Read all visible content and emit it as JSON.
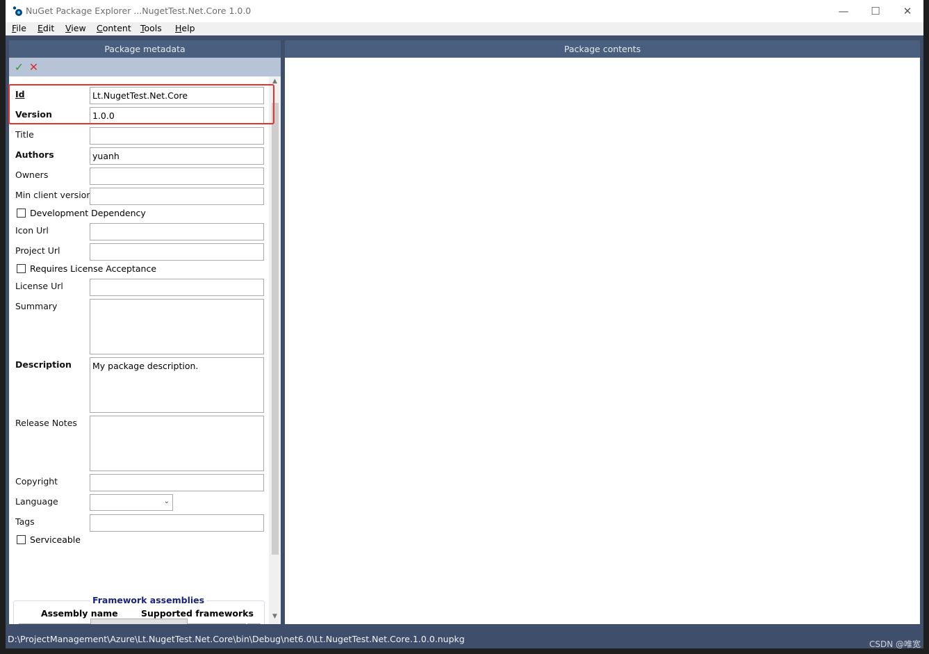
{
  "window": {
    "title": "NuGet Package Explorer ...NugetTest.Net.Core 1.0.0",
    "controls": {
      "minimize": "—",
      "maximize": "☐",
      "close": "✕"
    }
  },
  "menu": [
    "File",
    "Edit",
    "View",
    "Content",
    "Tools",
    "Help"
  ],
  "left_panel": {
    "header": "Package metadata",
    "toolbar": {
      "ok_icon": "check-icon",
      "ok_glyph": "✓",
      "cancel_icon": "x-icon",
      "cancel_glyph": "✕",
      "ok_color": "#2e9b3a",
      "cancel_color": "#d9302c"
    },
    "fields": {
      "id": {
        "label": "Id",
        "value": "Lt.NugetTest.Net.Core"
      },
      "version": {
        "label": "Version",
        "value": "1.0.0"
      },
      "title": {
        "label": "Title",
        "value": ""
      },
      "authors": {
        "label": "Authors",
        "value": "yuanh"
      },
      "owners": {
        "label": "Owners",
        "value": ""
      },
      "min_client_version": {
        "label": "Min client version",
        "value": ""
      },
      "development_dependency": {
        "label": "Development Dependency",
        "checked": false
      },
      "icon_url": {
        "label": "Icon Url",
        "value": ""
      },
      "project_url": {
        "label": "Project Url",
        "value": ""
      },
      "requires_license_acceptance": {
        "label": "Requires License Acceptance",
        "checked": false
      },
      "license_url": {
        "label": "License Url",
        "value": ""
      },
      "summary": {
        "label": "Summary",
        "value": ""
      },
      "description": {
        "label": "Description",
        "value": "My package description."
      },
      "release_notes": {
        "label": "Release Notes",
        "value": ""
      },
      "copyright": {
        "label": "Copyright",
        "value": ""
      },
      "language": {
        "label": "Language",
        "value": ""
      },
      "tags": {
        "label": "Tags",
        "value": ""
      },
      "serviceable": {
        "label": "Serviceable",
        "checked": false
      }
    },
    "framework_assemblies": {
      "title": "Framework assemblies",
      "col_assembly": "Assembly name",
      "col_frameworks": "Supported frameworks",
      "add_glyph": "+"
    },
    "highlight_color": "#e5322d"
  },
  "right_panel": {
    "header": "Package contents"
  },
  "status_bar": {
    "path": "D:\\ProjectManagement\\Azure\\Lt.NugetTest.Net.Core\\bin\\Debug\\net6.0\\Lt.NugetTest.Net.Core.1.0.0.nupkg"
  },
  "watermark": "CSDN @唯宽"
}
